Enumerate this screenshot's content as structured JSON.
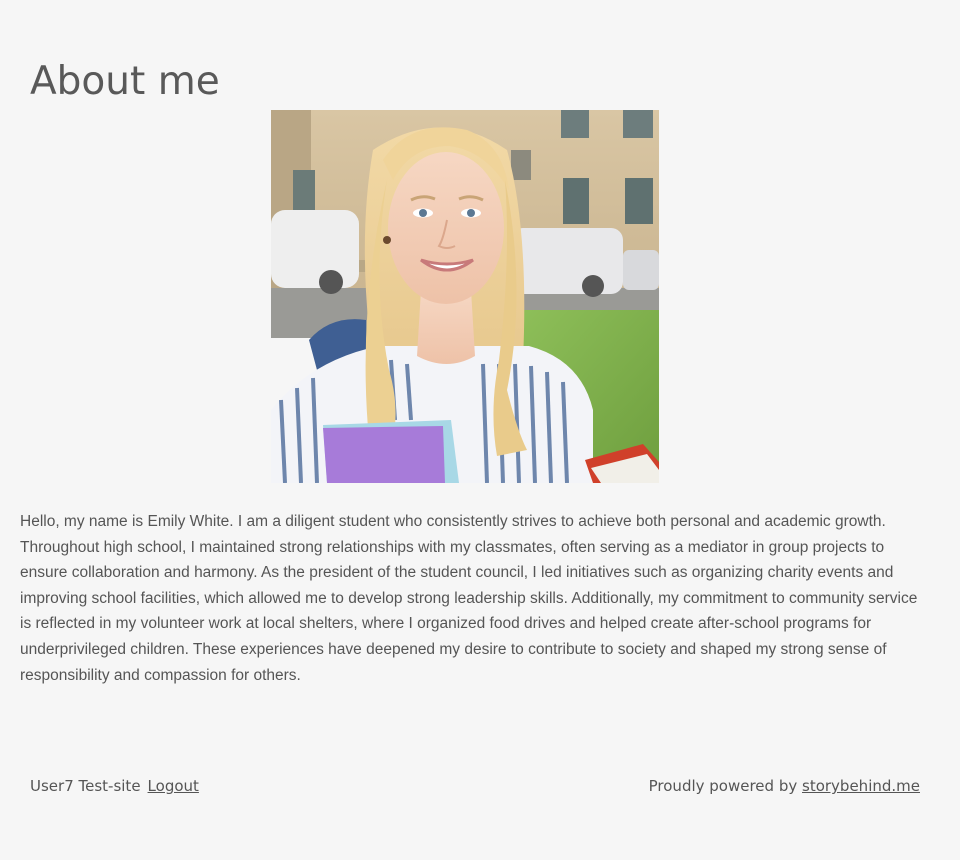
{
  "page": {
    "title": "About me"
  },
  "profile": {
    "bio": "Hello, my name is Emily White. I am a diligent student who consistently strives to achieve both personal and academic growth. Throughout high school, I maintained strong relationships with my classmates, often serving as a mediator in group projects to ensure collaboration and harmony. As the president of the student council, I led initiatives such as organizing charity events and improving school facilities, which allowed me to develop strong leadership skills. Additionally, my commitment to community service is reflected in my volunteer work at local shelters, where I organized food drives and helped create after-school programs for underprivileged children. These experiences have deepened my desire to contribute to society and shaped my strong sense of responsibility and compassion for others."
  },
  "footer": {
    "site_name": "User7 Test-site",
    "logout_label": "Logout",
    "powered_prefix": "Proudly powered by",
    "powered_link": "storybehind.me"
  },
  "colors": {
    "background": "#f6f6f6",
    "text": "#555555"
  }
}
